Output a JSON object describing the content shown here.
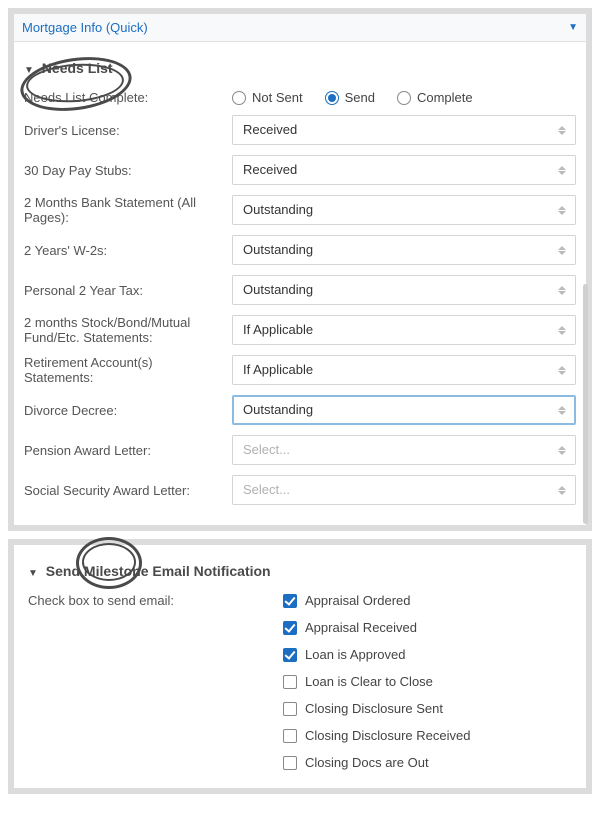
{
  "colors": {
    "accent": "#1b6ec2"
  },
  "header": {
    "title": "Mortgage Info (Quick)"
  },
  "needs_list": {
    "title": "Needs List",
    "complete": {
      "label": "Needs List Complete:",
      "options": {
        "not_sent": "Not Sent",
        "send": "Send",
        "complete": "Complete"
      },
      "selected": "send"
    },
    "fields": [
      {
        "label": "Driver's License:",
        "value": "Received",
        "placeholder": false,
        "active": false
      },
      {
        "label": "30 Day Pay Stubs:",
        "value": "Received",
        "placeholder": false,
        "active": false
      },
      {
        "label": "2 Months Bank Statement (All Pages):",
        "value": "Outstanding",
        "placeholder": false,
        "active": false
      },
      {
        "label": "2 Years' W-2s:",
        "value": "Outstanding",
        "placeholder": false,
        "active": false
      },
      {
        "label": "Personal 2 Year Tax:",
        "value": "Outstanding",
        "placeholder": false,
        "active": false
      },
      {
        "label": "2 months Stock/Bond/Mutual Fund/Etc. Statements:",
        "value": "If Applicable",
        "placeholder": false,
        "active": false
      },
      {
        "label": "Retirement Account(s) Statements:",
        "value": "If Applicable",
        "placeholder": false,
        "active": false
      },
      {
        "label": "Divorce Decree:",
        "value": "Outstanding",
        "placeholder": false,
        "active": true
      },
      {
        "label": "Pension Award Letter:",
        "value": "Select...",
        "placeholder": true,
        "active": false
      },
      {
        "label": "Social Security Award Letter:",
        "value": "Select...",
        "placeholder": true,
        "active": false
      }
    ]
  },
  "milestone": {
    "title": "Send Milestone Email Notification",
    "label": "Check box to send email:",
    "items": [
      {
        "label": "Appraisal Ordered",
        "checked": true
      },
      {
        "label": "Appraisal Received",
        "checked": true
      },
      {
        "label": "Loan is Approved",
        "checked": true
      },
      {
        "label": "Loan is Clear to Close",
        "checked": false
      },
      {
        "label": "Closing Disclosure Sent",
        "checked": false
      },
      {
        "label": "Closing Disclosure Received",
        "checked": false
      },
      {
        "label": "Closing Docs are Out",
        "checked": false
      }
    ]
  }
}
